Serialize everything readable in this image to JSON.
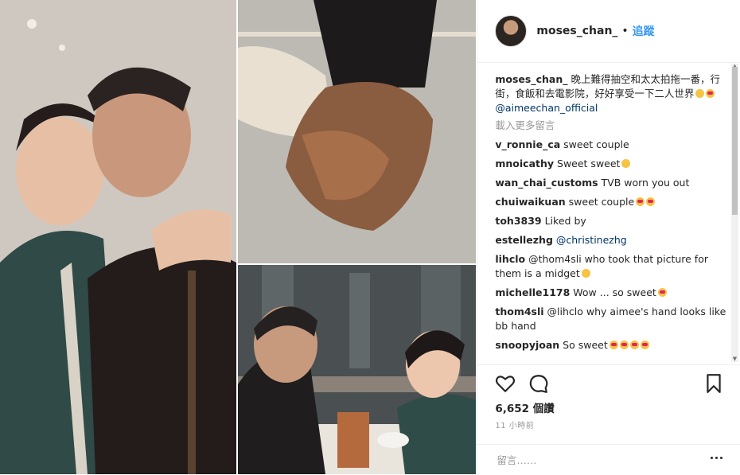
{
  "header": {
    "username": "moses_chan_",
    "separator": "•",
    "follow_label": "追蹤"
  },
  "caption": {
    "username": "moses_chan_",
    "text": "晚上難得抽空和太太拍拖一番，行街，食飯和去電影院，好好享受一下二人世界",
    "mention": "@aimeechan_official"
  },
  "load_more_label": "載入更多留言",
  "comments": [
    {
      "user": "v_ronnie_ca",
      "text": "sweet couple",
      "emoji": ""
    },
    {
      "user": "mnoicathy",
      "text": "Sweet sweet",
      "emoji": "grin"
    },
    {
      "user": "wan_chai_customs",
      "text": "TVB worn you out",
      "emoji": ""
    },
    {
      "user": "chuiwaikuan",
      "text": "sweet couple",
      "emoji": "heart-eyes x2"
    },
    {
      "user": "toh3839",
      "text": "Liked by",
      "emoji": ""
    },
    {
      "user": "estellezhg",
      "text": "@christinezhg",
      "emoji": ""
    },
    {
      "user": "lihclo",
      "text": "@thom4sli who took that picture for them is a midget",
      "emoji": "shocked"
    },
    {
      "user": "michelle1178",
      "text": "Wow ... so sweet",
      "emoji": "couple"
    },
    {
      "user": "thom4sli",
      "text": "@lihclo why aimee's hand looks like bb hand",
      "emoji": ""
    },
    {
      "user": "snoopyjoan",
      "text": "So sweet",
      "emoji": "heart-eyes x4"
    }
  ],
  "actions": {
    "like_icon": "heart-icon",
    "comment_icon": "comment-icon",
    "save_icon": "bookmark-icon",
    "likes": "6,652 個讚",
    "time": "11 小時前"
  },
  "add_comment": {
    "placeholder": "留言……",
    "more_icon": "more-options-icon"
  },
  "colors": {
    "link": "#3897f0",
    "mention": "#003569",
    "muted": "#999999",
    "divider": "#efefef"
  }
}
